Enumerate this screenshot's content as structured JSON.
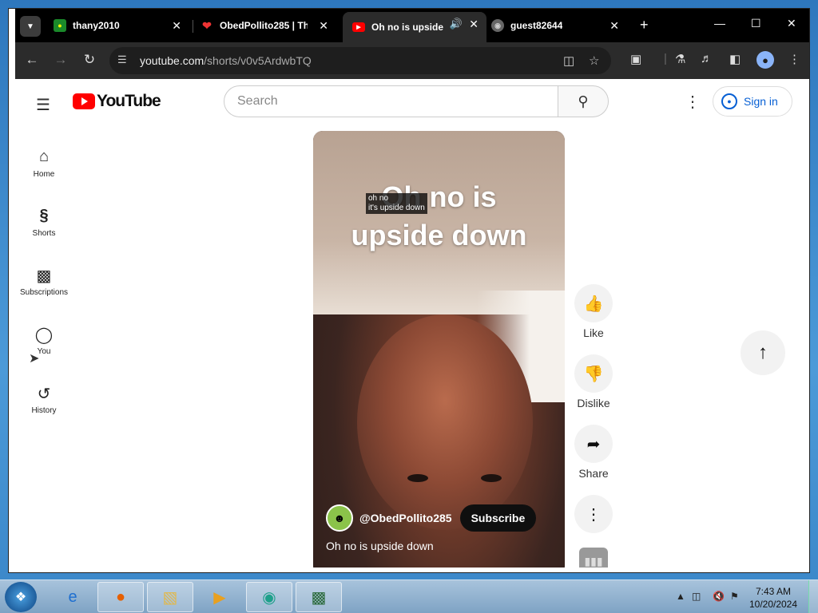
{
  "browser": {
    "tabs": [
      {
        "title": "thany2010"
      },
      {
        "title": "ObedPollito285 | Th"
      },
      {
        "title": "Oh no is upside"
      },
      {
        "title": "guest82644"
      }
    ],
    "url_host": "youtube.com",
    "url_path": "/shorts/v0v5ArdwbTQ"
  },
  "youtube": {
    "logo_text": "YouTube",
    "search_placeholder": "Search",
    "signin_label": "Sign in",
    "sidebar": [
      {
        "label": "Home"
      },
      {
        "label": "Shorts"
      },
      {
        "label": "Subscriptions"
      },
      {
        "label": "You"
      },
      {
        "label": "History"
      }
    ]
  },
  "short": {
    "overlay_line1": "Oh no is",
    "overlay_line2": "upside down",
    "caption_line1": "oh no",
    "caption_line2": "it's upside down",
    "channel_handle": "@ObedPollito285",
    "subscribe_label": "Subscribe",
    "description": "Oh no is upside down",
    "actions": {
      "like": "Like",
      "dislike": "Dislike",
      "share": "Share"
    }
  },
  "taskbar": {
    "time": "7:43 AM",
    "date": "10/20/2024"
  }
}
